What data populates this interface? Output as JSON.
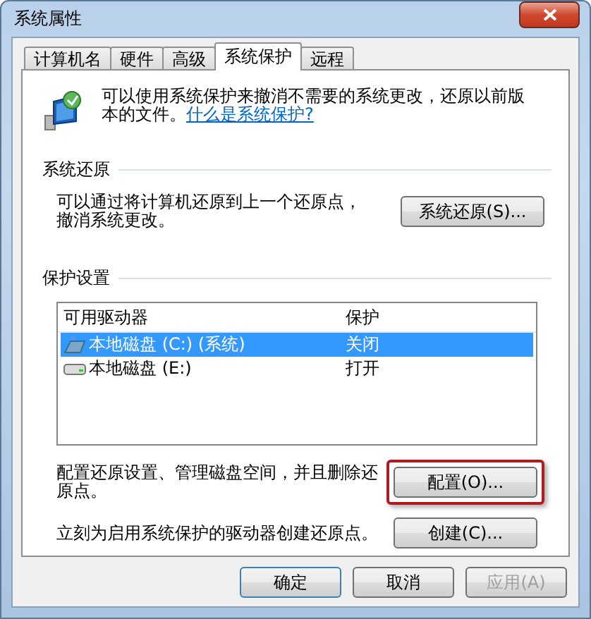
{
  "window": {
    "title": "系统属性"
  },
  "tabs": [
    {
      "label": "计算机名",
      "selected": false
    },
    {
      "label": "硬件",
      "selected": false
    },
    {
      "label": "高级",
      "selected": false
    },
    {
      "label": "系统保护",
      "selected": true
    },
    {
      "label": "远程",
      "selected": false
    }
  ],
  "intro": {
    "text": "可以使用系统保护来撤消不需要的系统更改，还原以前版本的文件。",
    "link": "什么是系统保护?"
  },
  "system_restore": {
    "heading": "系统还原",
    "text": "可以通过将计算机还原到上一个还原点，撤消系统更改。",
    "button": "系统还原(S)..."
  },
  "protection_settings": {
    "heading": "保护设置",
    "columns": [
      "可用驱动器",
      "保护"
    ],
    "rows": [
      {
        "drive": "本地磁盘 (C:) (系统)",
        "protection": "关闭",
        "kind": "system",
        "selected": true
      },
      {
        "drive": "本地磁盘 (E:)",
        "protection": "打开",
        "kind": "plain",
        "selected": false
      }
    ],
    "actions": [
      {
        "text": "配置还原设置、管理磁盘空间，并且删除还原点。",
        "button": "配置(O)...",
        "highlighted": true
      },
      {
        "text": "立刻为启用系统保护的驱动器创建还原点。",
        "button": "创建(C)...",
        "highlighted": false
      }
    ]
  },
  "footer_buttons": [
    {
      "label": "确定",
      "disabled": false,
      "default": true
    },
    {
      "label": "取消",
      "disabled": false,
      "default": false
    },
    {
      "label": "应用(A)",
      "disabled": true,
      "default": false
    }
  ]
}
